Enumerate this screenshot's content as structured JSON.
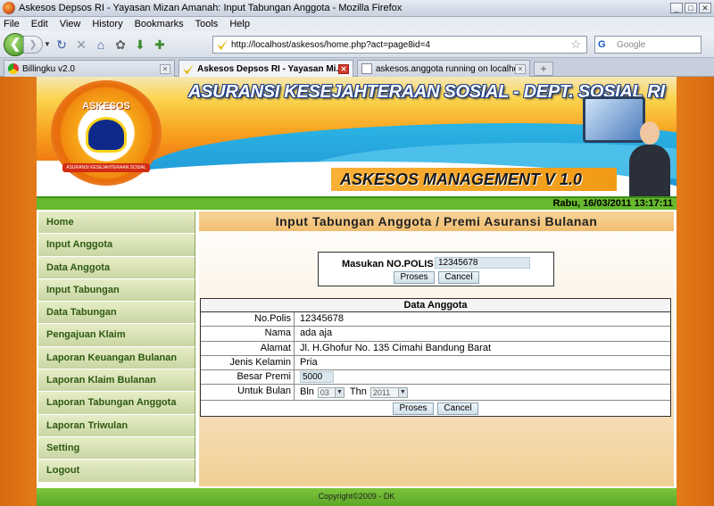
{
  "window": {
    "title": "Askesos Depsos RI - Yayasan Mizan Amanah: Input Tabungan Anggota - Mozilla Firefox",
    "min_symbol": "_",
    "max_symbol": "□",
    "close_symbol": "✕"
  },
  "menubar": {
    "items": [
      {
        "key": "F",
        "label": "File"
      },
      {
        "key": "E",
        "label": "Edit"
      },
      {
        "key": "V",
        "label": "View"
      },
      {
        "key": "H",
        "label": "History"
      },
      {
        "key": "B",
        "label": "Bookmarks"
      },
      {
        "key": "T",
        "label": "Tools"
      },
      {
        "key": "H",
        "label": "Help"
      }
    ]
  },
  "navbar": {
    "back_symbol": "❮",
    "forward_symbol": "❯",
    "url": "http://localhost/askesos/home.php?act=page8id=4",
    "search_engine": "G",
    "search_placeholder": "Google"
  },
  "tabs": [
    {
      "label": "Billingku v2.0",
      "active": false
    },
    {
      "label": "Askesos Depsos RI - Yayasan Mi...",
      "active": true
    },
    {
      "label": "askesos.anggota running on localhost -...",
      "active": false
    }
  ],
  "banner": {
    "title": "ASURANSI KESEJAHTERAAN SOSIAL - DEPT. SOSIAL RI",
    "subtitle": "ASKESOS MANAGEMENT V 1.0",
    "logo_text": "ASKESOS",
    "logo_band": "ASURANSI KESEJAHTERAAN SOSIAL"
  },
  "datetime": "Rabu, 16/03/2011 13:17:11",
  "sidebar": {
    "items": [
      "Home",
      "Input Anggota",
      "Data Anggota",
      "Input Tabungan",
      "Data Tabungan",
      "Pengajuan Klaim",
      "Laporan Keuangan Bulanan",
      "Laporan Klaim Bulanan",
      "Laporan Tabungan Anggota",
      "Laporan Triwulan",
      "Setting",
      "Logout"
    ]
  },
  "content": {
    "heading": "Input Tabungan Anggota / Premi Asuransi Bulanan",
    "polis": {
      "label": "Masukan NO.POLIS",
      "value": "12345678",
      "proses": "Proses",
      "cancel": "Cancel"
    },
    "data": {
      "title": "Data Anggota",
      "rows": [
        {
          "key": "No.Polis",
          "value": "12345678"
        },
        {
          "key": "Nama",
          "value": "ada aja"
        },
        {
          "key": "Alamat",
          "value": "Jl. H.Ghofur No. 135 Cimahi Bandung Barat"
        },
        {
          "key": "Jenis Kelamin",
          "value": "Pria"
        }
      ],
      "premi_label": "Besar Premi",
      "premi_value": "5000",
      "bulan_label": "Untuk Bulan",
      "bln_label": "Bln",
      "bln_value": "03",
      "thn_label": "Thn",
      "thn_value": "2011",
      "proses": "Proses",
      "cancel": "Cancel"
    }
  },
  "footer": "Copyright©2009 - DK",
  "colors": {
    "accent_orange": "#e27a1a",
    "sidebar_green": "#c9d6a3",
    "datebar_green": "#67b92d"
  }
}
